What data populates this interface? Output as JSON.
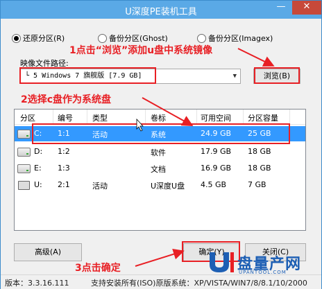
{
  "window": {
    "title": "U深度PE装机工具",
    "minimize": "—",
    "close": "✕"
  },
  "radios": [
    {
      "label": "还原分区(R)",
      "checked": true
    },
    {
      "label": "备份分区(Ghost)",
      "checked": false
    },
    {
      "label": "备份分区(Imagex)",
      "checked": false
    }
  ],
  "image_path": {
    "label": "映像文件路径:",
    "value": "└ 5 Windows 7 旗舰版 [7.9 GB]",
    "browse_label": "浏览(B)"
  },
  "table": {
    "headers": [
      "分区",
      "编号",
      "类型",
      "卷标",
      "可用空间",
      "分区容量"
    ],
    "rows": [
      {
        "icon": "hard-drive-icon",
        "drive": "C:",
        "num": "1:1",
        "type": "活动",
        "label": "系统",
        "free": "24.9 GB",
        "size": "25 GB",
        "selected": true
      },
      {
        "icon": "hard-drive-icon",
        "drive": "D:",
        "num": "1:2",
        "type": "",
        "label": "软件",
        "free": "17.9 GB",
        "size": "18 GB",
        "selected": false
      },
      {
        "icon": "hard-drive-icon",
        "drive": "E:",
        "num": "1:3",
        "type": "",
        "label": "文档",
        "free": "16.9 GB",
        "size": "18 GB",
        "selected": false
      },
      {
        "icon": "usb-drive-icon",
        "drive": "U:",
        "num": "2:1",
        "type": "活动",
        "label": "U深度U盘",
        "free": "4.5 GB",
        "size": "7 GB",
        "selected": false
      }
    ]
  },
  "buttons": {
    "advanced": "高级(A)",
    "confirm": "确定(Y)",
    "cancel": "关闭(C)"
  },
  "status": {
    "version": "版本：3.3.16.111",
    "support": "支持安装所有(ISO)原版系统：XP/VISTA/WIN7/8/8.1/10/2000"
  },
  "annotations": {
    "step1": "1点击“浏览”添加u盘中系统镜像",
    "step2": "2选择c盘作为系统盘",
    "step3": "3点击确定"
  },
  "watermark": {
    "text": "盘量产网",
    "sub": "UPANTOOL.COM"
  },
  "colors": {
    "titlebar": "#5aa9e6",
    "selection": "#3399ff",
    "annotation": "#e81f24",
    "close": "#c7493a"
  }
}
